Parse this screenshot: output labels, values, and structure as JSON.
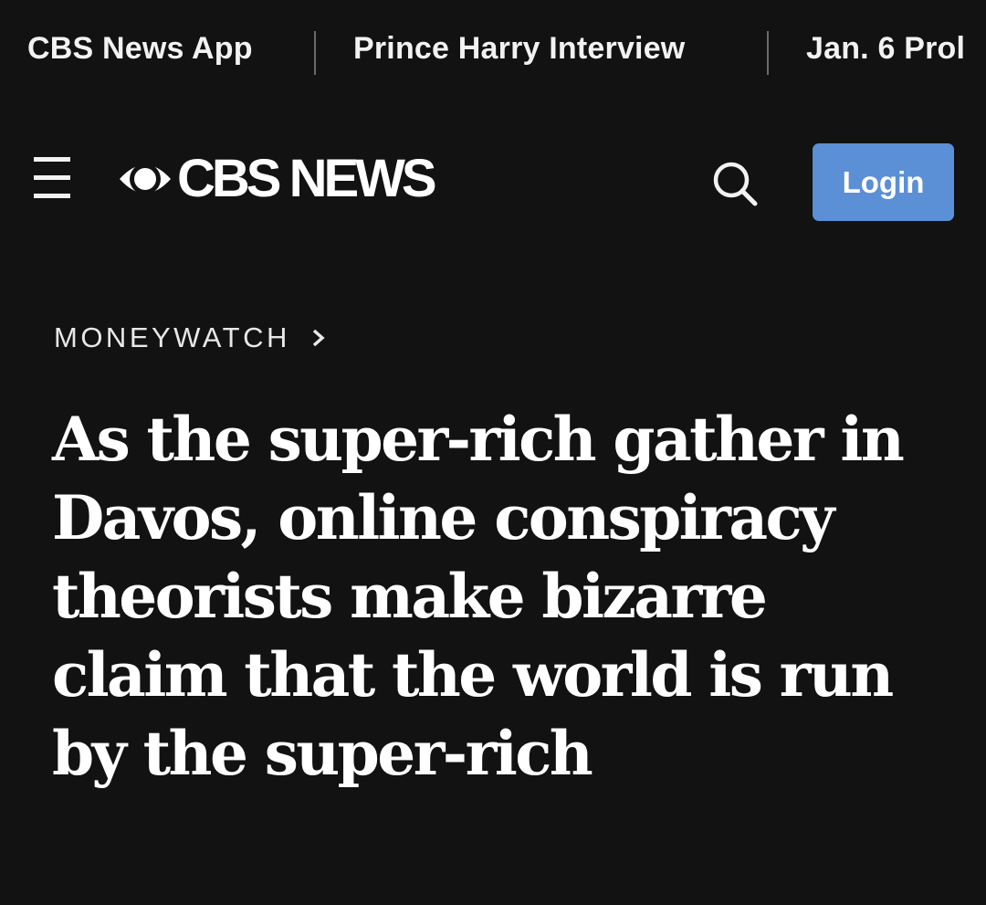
{
  "topbar": {
    "links": [
      "CBS News App",
      "Prince Harry Interview",
      "Jan. 6 Prol"
    ]
  },
  "header": {
    "logo_text": "CBS NEWS",
    "menu_icon": "hamburger-menu-icon",
    "search_icon": "search-icon",
    "login_label": "Login"
  },
  "section": {
    "label": "MONEYWATCH",
    "chevron_icon": "chevron-right-icon"
  },
  "article": {
    "headline": "As the super-rich gather in Davos, online conspiracy theorists make bizarre claim that the world is run by the super-rich"
  },
  "colors": {
    "background": "#121212",
    "text": "#ffffff",
    "login_button": "#5b8fd6",
    "divider": "#6a6a6a"
  }
}
